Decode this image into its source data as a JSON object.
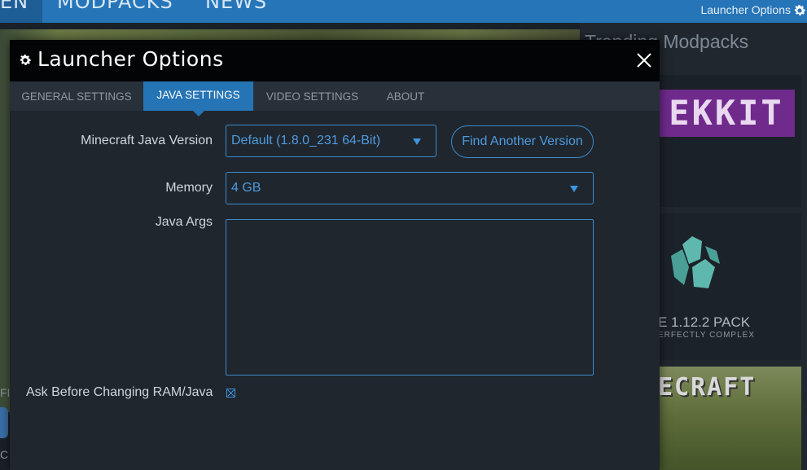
{
  "topbar": {
    "nav_frag_1": "EN",
    "nav_frag_2": "MODPACKS",
    "nav_frag_3": "NEWS",
    "launcher_options": "Launcher Options",
    "gear_icon": "gear-icon"
  },
  "background": {
    "trending_title": "Trending Modpacks",
    "tile1_logo": "EKKIT",
    "tile2_name": "E 1.12.2 PACK",
    "tile2_tag": "ERFECTLY COMPLEX",
    "tile3_logo": "ECRAFT",
    "left_frag_1": "FI",
    "left_frag_2": "C"
  },
  "dialog": {
    "title": "Launcher Options",
    "close_icon": "close-icon",
    "tabs": [
      {
        "label": "GENERAL SETTINGS",
        "active": false
      },
      {
        "label": "JAVA SETTINGS",
        "active": true
      },
      {
        "label": "VIDEO SETTINGS",
        "active": false
      },
      {
        "label": "ABOUT",
        "active": false
      }
    ],
    "java_version": {
      "label": "Minecraft Java Version",
      "value": "Default (1.8.0_231 64-Bit)",
      "find_button": "Find Another Version"
    },
    "memory": {
      "label": "Memory",
      "value": "4 GB"
    },
    "java_args": {
      "label": "Java Args",
      "value": ""
    },
    "ask_before": {
      "label": "Ask Before Changing RAM/Java",
      "checked": true
    }
  },
  "colors": {
    "accent": "#2574b5",
    "field_border": "#3b8ccf",
    "field_text": "#4d9be0",
    "dialog_bg": "#1f262d",
    "titlebar_bg": "#030405"
  }
}
